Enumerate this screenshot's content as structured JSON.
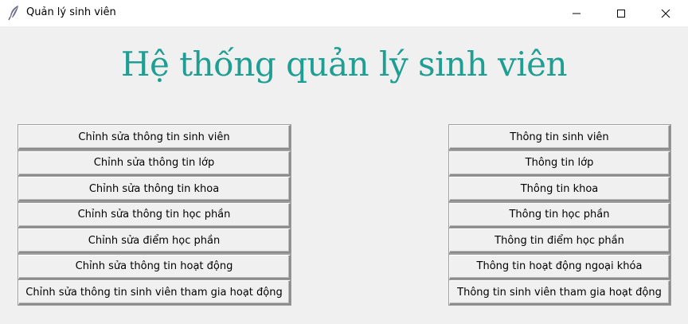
{
  "window": {
    "title": "Quản lý sinh viên",
    "icon": "feather-icon",
    "controls": [
      "minimize-icon",
      "maximize-icon",
      "close-icon"
    ]
  },
  "heading": "Hệ thống quản lý sinh viên",
  "colors": {
    "heading": "#1f9e93",
    "background": "#f0f0f0"
  },
  "left_buttons": [
    "Chỉnh sửa thông tin sinh viên",
    "Chỉnh sửa thông tin lớp",
    "Chỉnh sửa thông tin khoa",
    "Chỉnh sửa thông tin học phần",
    "Chỉnh sửa điểm học phần",
    "Chỉnh sửa thông tin hoạt động",
    "Chỉnh sửa thông tin sinh viên tham gia hoạt động"
  ],
  "right_buttons": [
    "Thông tin sinh viên",
    "Thông tin lớp",
    "Thông tin khoa",
    "Thông tin học phần",
    "Thông tin điểm học phần",
    "Thông tin hoạt động ngoại khóa",
    "Thông tin sinh viên tham gia hoạt động"
  ]
}
